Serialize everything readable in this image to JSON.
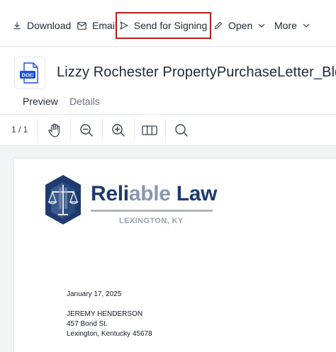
{
  "toolbar": {
    "download_label": "Download",
    "email_label": "Email",
    "sign_label": "Send for Signing",
    "open_label": "Open",
    "more_label": "More",
    "highlight_color": "#b91c1c"
  },
  "document": {
    "icon_label": "DOC",
    "title": "Lizzy Rochester PropertyPurchaseLetter_Bldr"
  },
  "tabs": {
    "preview": "Preview",
    "details": "Details",
    "active_color": "#1d4ed8"
  },
  "viewer": {
    "page_count": "1 / 1",
    "tools": [
      "hand-icon",
      "zoom-out-icon",
      "zoom-in-icon",
      "columns-icon",
      "search-icon"
    ]
  },
  "letter": {
    "logo": {
      "word_part1": "Reli",
      "word_part2": "able",
      "word_part3": " Law",
      "city": "LEXINGTON, KY",
      "navy": "#1e3a6e",
      "slate": "#8a97ae"
    },
    "date": "January 17, 2025",
    "recipient_name": "JEREMY HENDERSON",
    "address_line1": "457 Bond St.",
    "address_line2": "Lexington, Kentucky 45678"
  }
}
